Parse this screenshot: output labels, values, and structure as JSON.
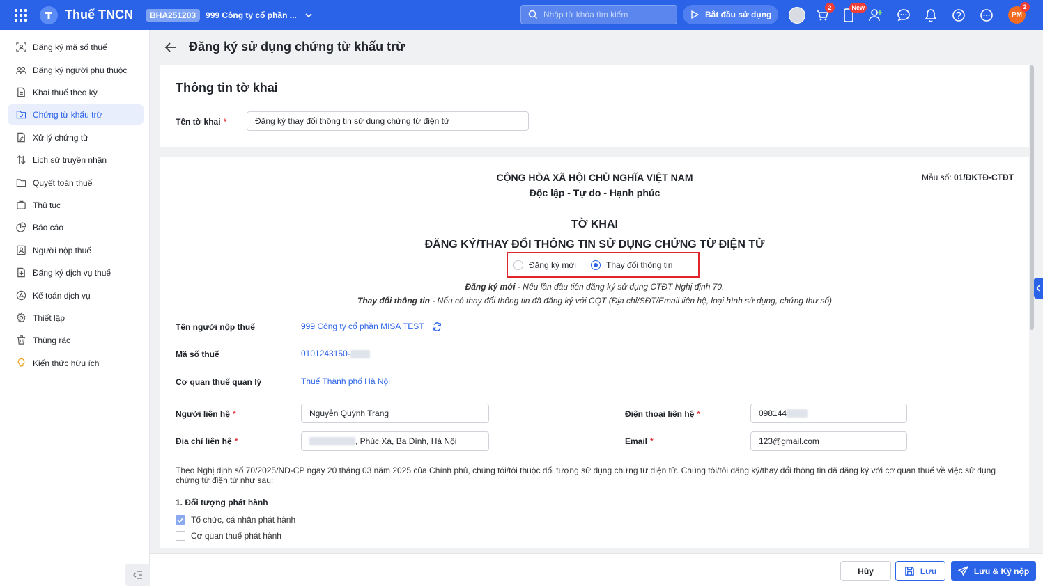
{
  "topbar": {
    "app_name": "Thuế TNCN",
    "org_code": "BHA251203",
    "org_name": "999 Công ty cổ phần ...",
    "search_placeholder": "Nhập từ khóa tìm kiếm",
    "start_label": "Bắt đầu sử dụng",
    "cart_badge": "2",
    "new_badge": "New",
    "avatar_initials": "PM",
    "avatar_badge": "2",
    "brand_color": "#2b63e8"
  },
  "sidebar": {
    "items": [
      {
        "label": "Đăng ký mã số thuế",
        "icon": "scan-id-icon"
      },
      {
        "label": "Đăng ký người phụ thuộc",
        "icon": "users-icon"
      },
      {
        "label": "Khai thuế theo kỳ",
        "icon": "document-icon"
      },
      {
        "label": "Chứng từ khấu trừ",
        "icon": "folder-check-icon"
      },
      {
        "label": "Xử lý chứng từ",
        "icon": "doc-edit-icon"
      },
      {
        "label": "Lịch sử truyền nhận",
        "icon": "transfer-icon"
      },
      {
        "label": "Quyết toán thuế",
        "icon": "folder-icon"
      },
      {
        "label": "Thủ tục",
        "icon": "clipboard-icon"
      },
      {
        "label": "Báo cáo",
        "icon": "pie-chart-icon"
      },
      {
        "label": "Người nộp thuế",
        "icon": "person-card-icon"
      },
      {
        "label": "Đăng ký dịch vụ thuế",
        "icon": "doc-add-icon"
      },
      {
        "label": "Kế toán dịch vụ",
        "icon": "calculator-icon"
      },
      {
        "label": "Thiết lập",
        "icon": "gear-icon"
      },
      {
        "label": "Thùng rác",
        "icon": "trash-icon"
      },
      {
        "label": "Kiến thức hữu ích",
        "icon": "lightbulb-icon"
      }
    ]
  },
  "header": {
    "title": "Đăng ký sử dụng chứng từ khấu trừ"
  },
  "card1": {
    "title": "Thông tin tờ khai",
    "name_label": "Tên tờ khai",
    "name_value": "Đăng ký thay đổi thông tin sử dụng chứng từ điện tử"
  },
  "form": {
    "national_line1": "CỘNG HÒA XÃ HỘI CHỦ NGHĨA VIỆT NAM",
    "national_line2": "Độc lập - Tự do - Hạnh phúc",
    "form_code_label": "Mẫu số:",
    "form_code_value": "01/ĐKTĐ-CTĐT",
    "title1": "TỜ KHAI",
    "title2": "ĐĂNG KÝ/THAY ĐỔI THÔNG TIN SỬ DỤNG CHỨNG TỪ ĐIỆN TỬ",
    "radio_new": "Đăng ký mới",
    "radio_change": "Thay đổi thông tin",
    "selected": "Thay đổi thông tin",
    "note1_bold": "Đăng ký mới",
    "note1_text": " - Nếu lần đầu tiên đăng ký sử dụng CTĐT Nghị định 70.",
    "note2_bold": "Thay đổi thông tin",
    "note2_text": " - Nếu có thay đổi thông tin đã đăng ký với CQT (Địa chỉ/SĐT/Email liên hệ, loại hình sử dụng, chứng thư số)",
    "taxpayer_label": "Tên người nộp thuế",
    "taxpayer_value": "999 Công ty cổ phần MISA TEST",
    "tax_code_label": "Mã số thuế",
    "tax_code_value": "0101243150-",
    "authority_label": "Cơ quan thuế quản lý",
    "authority_value": "Thuế Thành phố Hà Nội",
    "contact_label": "Người liên hệ",
    "contact_value": "Nguyễn Quỳnh Trang",
    "phone_label": "Điện thoại liên hệ",
    "phone_value": "098144",
    "address_label": "Địa chỉ liên hệ",
    "address_value": ", Phúc Xá, Ba Đình, Hà Nội",
    "email_label": "Email",
    "email_value": "123@gmail.com",
    "paragraph": "Theo Nghị định số 70/2025/NĐ-CP ngày 20 tháng 03 năm 2025 của Chính phủ, chúng tôi/tôi thuộc đối tượng sử dụng chứng từ điện tử. Chúng tôi/tôi đăng ký/thay đổi thông tin đã đăng ký với cơ quan thuế về việc sử dụng chứng từ điện tử như sau:",
    "section1": "1. Đối tượng phát hành",
    "check1": "Tổ chức, cá nhân phát hành",
    "check1_checked": true,
    "check2": "Cơ quan thuế phát hành",
    "check2_checked": false
  },
  "footer": {
    "cancel": "Hủy",
    "save": "Lưu",
    "submit": "Lưu & Ký nộp"
  }
}
